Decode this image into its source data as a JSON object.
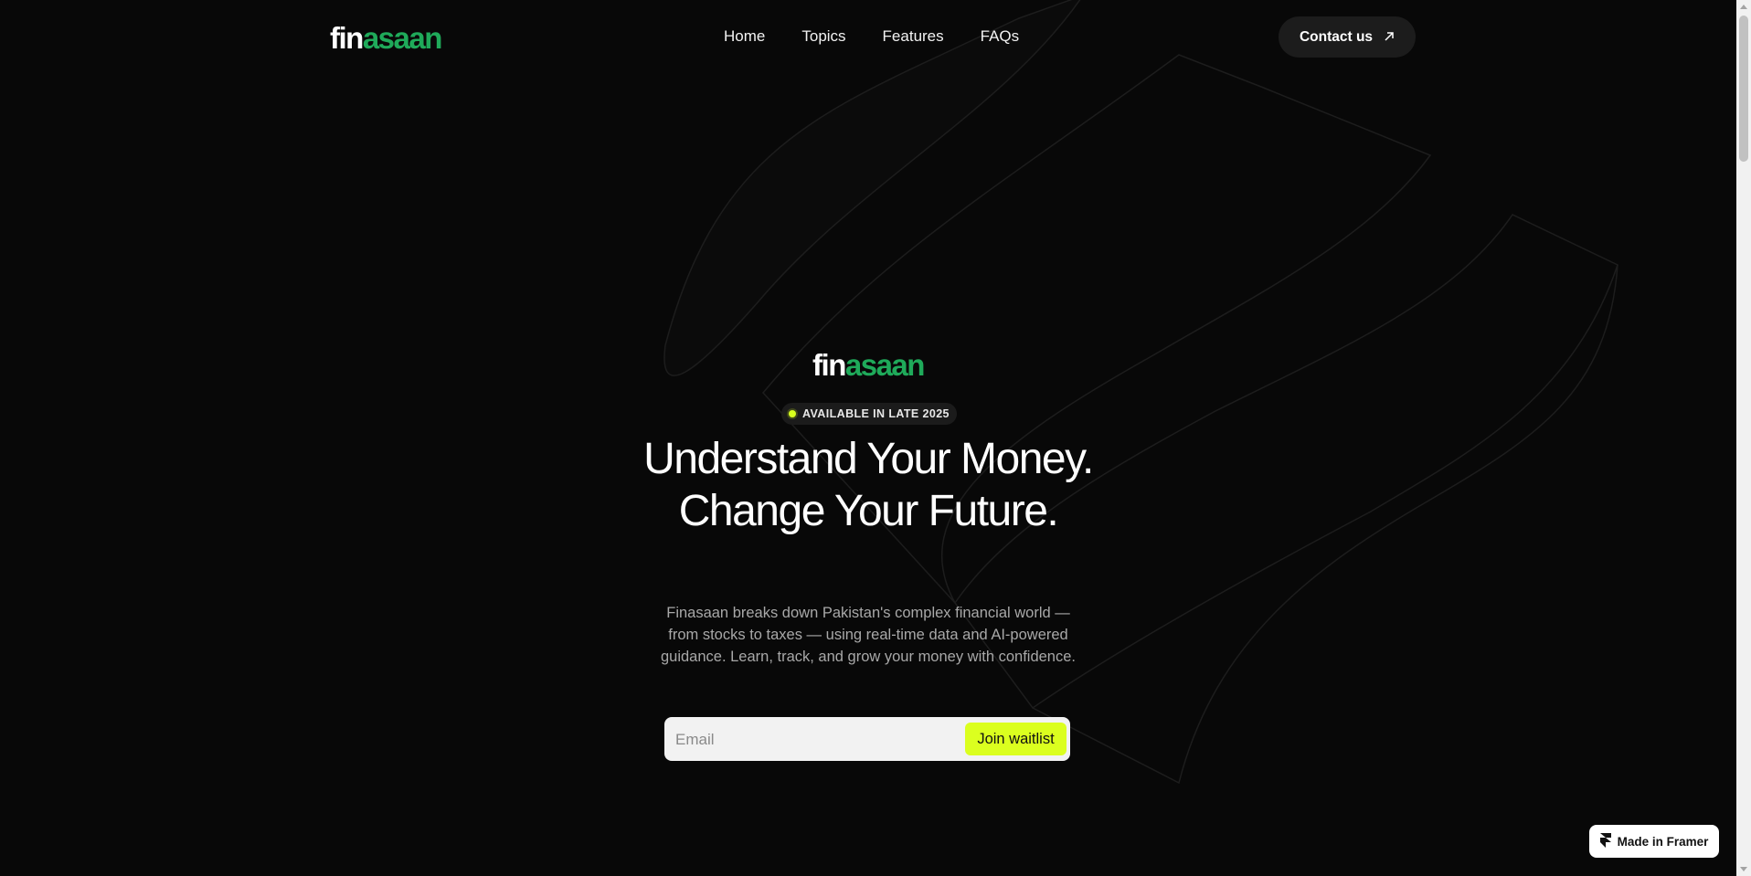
{
  "brand": {
    "logo_part1": "fin",
    "logo_part2": "asaan",
    "accent_color": "#1faa5a"
  },
  "nav": {
    "items": [
      {
        "label": "Home"
      },
      {
        "label": "Topics"
      },
      {
        "label": "Features"
      },
      {
        "label": "FAQs"
      }
    ],
    "contact_label": "Contact us",
    "contact_icon": "arrow-up-right-icon"
  },
  "hero": {
    "logo_part1": "fin",
    "logo_part2": "asaan",
    "badge": "AVAILABLE IN LATE 2025",
    "badge_dot_color": "#d7ff1e",
    "headline": "Understand Your Money. Change Your Future.",
    "subtext": "Finasaan breaks down Pakistan's complex financial world — from stocks to taxes — using real-time data and AI-powered guidance. Learn, track, and grow your money with confidence.",
    "email_placeholder": "Email",
    "email_value": "",
    "join_label": "Join waitlist",
    "join_color": "#dbff1f"
  },
  "framer_badge": {
    "label": "Made in Framer",
    "icon": "framer-icon"
  }
}
